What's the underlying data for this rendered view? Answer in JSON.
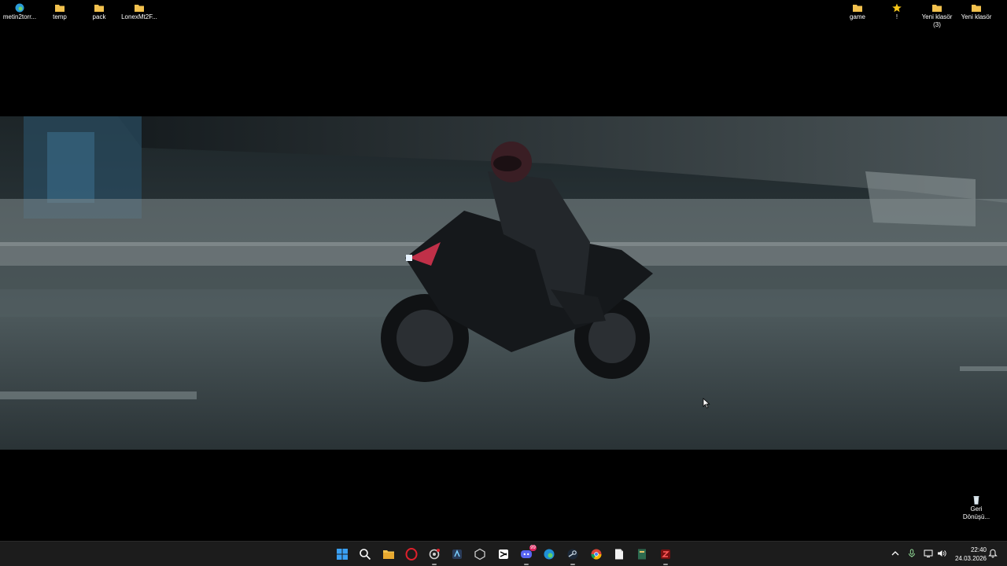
{
  "desktop": {
    "left_icons": [
      {
        "name": "edge-icon",
        "label": "metin2torr..."
      },
      {
        "name": "folder-icon",
        "label": "temp"
      },
      {
        "name": "folder-icon",
        "label": "pack"
      },
      {
        "name": "folder-icon",
        "label": "LonexMt2F..."
      }
    ],
    "right_icons": [
      {
        "name": "folder-icon",
        "label": "game"
      },
      {
        "name": "star-icon",
        "label": "!"
      },
      {
        "name": "folder-icon",
        "label": "Yeni klasör (3)"
      },
      {
        "name": "folder-icon",
        "label": "Yeni klasör"
      }
    ],
    "recycle_bin": {
      "label": "Geri Dönüşü..."
    }
  },
  "taskbar": {
    "apps": [
      {
        "name": "start-button-windows-icon"
      },
      {
        "name": "search-icon"
      },
      {
        "name": "file-explorer-icon"
      },
      {
        "name": "opera-icon"
      },
      {
        "name": "app-gear-icon"
      },
      {
        "name": "app-blue-icon"
      },
      {
        "name": "app-cube-icon"
      },
      {
        "name": "capcut-icon"
      },
      {
        "name": "discord-icon",
        "badge": "99"
      },
      {
        "name": "edge-icon"
      },
      {
        "name": "steam-icon"
      },
      {
        "name": "chrome-icon"
      },
      {
        "name": "notepad-icon"
      },
      {
        "name": "app-book-icon"
      },
      {
        "name": "app-red-icon"
      }
    ],
    "clock": {
      "time": "22:40",
      "date": "24.03.2026"
    }
  },
  "colors": {
    "taskbar_bg": "#1c1c1c",
    "folder": "#f2c14e",
    "accent": "#0078d4"
  }
}
